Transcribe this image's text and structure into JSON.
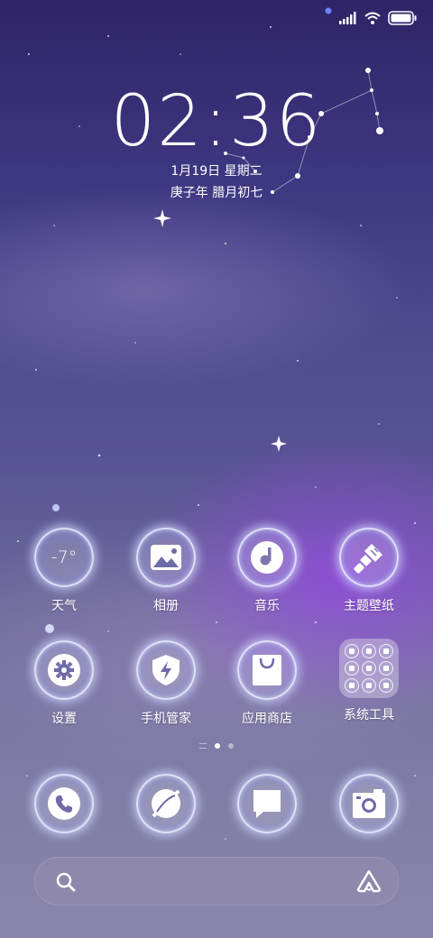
{
  "status_bar": {
    "signal_icon": "signal-icon",
    "wifi_icon": "wifi-icon",
    "battery_icon": "battery-icon"
  },
  "clock": {
    "time": "02:36"
  },
  "date": {
    "gregorian": "1月19日 星期二",
    "lunar": "庚子年 腊月初七"
  },
  "apps_row1": [
    {
      "label": "天气",
      "icon": "weather-icon",
      "temp": "-7°"
    },
    {
      "label": "相册",
      "icon": "gallery-icon"
    },
    {
      "label": "音乐",
      "icon": "music-icon"
    },
    {
      "label": "主题壁纸",
      "icon": "theme-brush-icon"
    }
  ],
  "apps_row2": [
    {
      "label": "设置",
      "icon": "settings-gear-icon"
    },
    {
      "label": "手机管家",
      "icon": "security-shield-icon"
    },
    {
      "label": "应用商店",
      "icon": "app-store-bag-icon"
    },
    {
      "label": "系统工具",
      "icon": "folder-icon"
    }
  ],
  "folder_minis": [
    "mini-app-1",
    "mini-app-2",
    "mini-app-3",
    "mini-app-4",
    "mini-app-5",
    "mini-app-6",
    "mini-app-7",
    "mini-app-8",
    "mini-app-9"
  ],
  "page_indicator": {
    "pages": 2,
    "current": 1
  },
  "dock": [
    {
      "icon": "phone-icon"
    },
    {
      "icon": "browser-icon"
    },
    {
      "icon": "messages-icon"
    },
    {
      "icon": "camera-icon"
    }
  ],
  "search": {
    "search_icon": "search-icon",
    "assistant_icon": "assistant-icon"
  },
  "colors": {
    "accent": "#ffffff",
    "bg_top": "#2f2466",
    "bg_bottom": "#8a86ab",
    "nebula": "#9646e6"
  }
}
